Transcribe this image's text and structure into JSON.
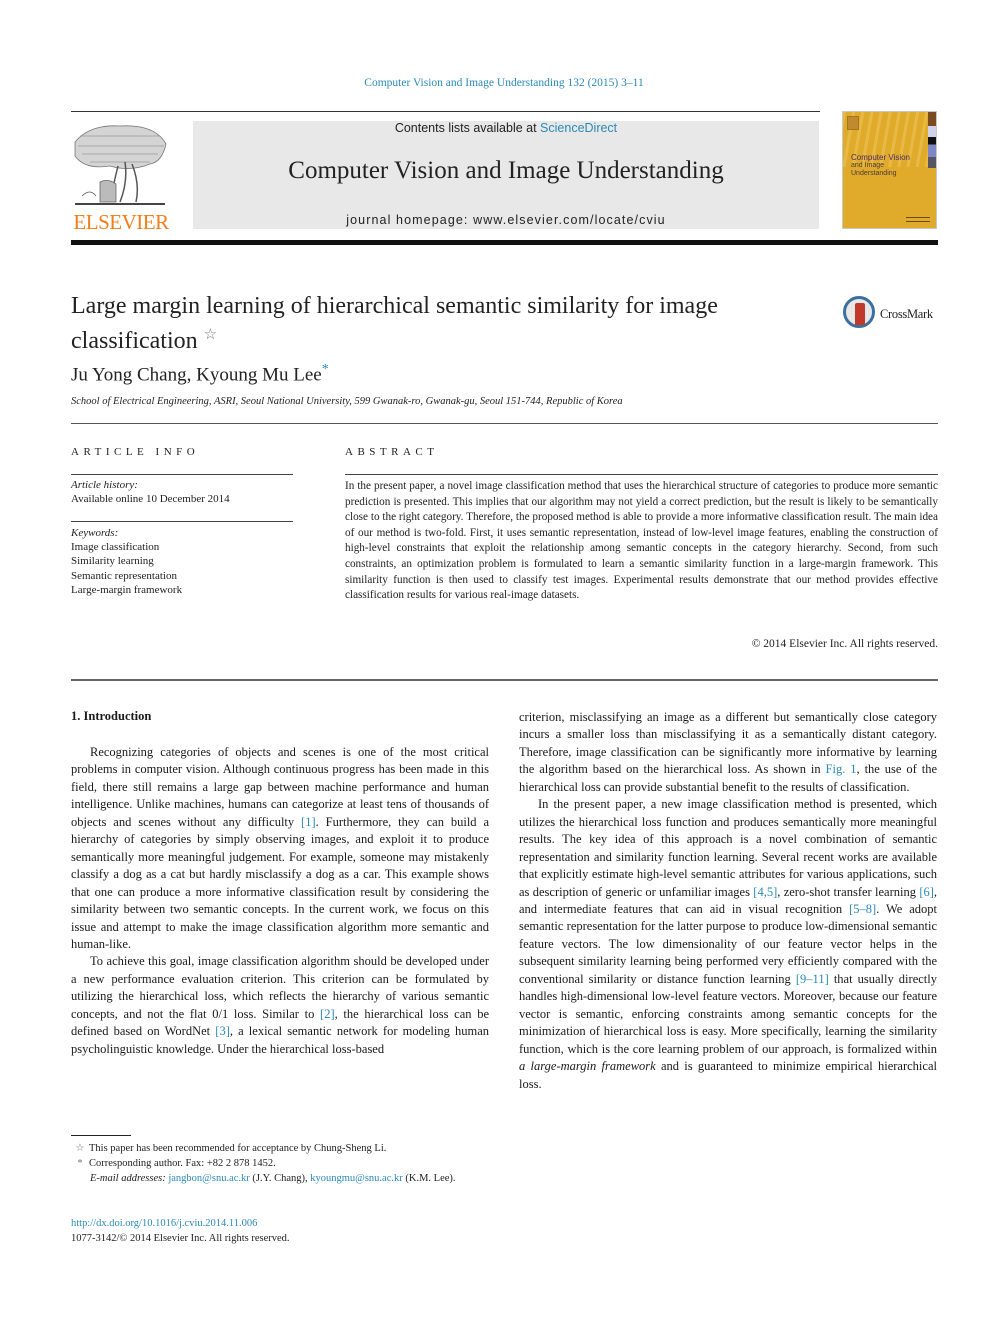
{
  "header": {
    "journal_reference": "Computer Vision and Image Understanding 132 (2015) 3–11",
    "contents_prefix": "Contents lists available at ",
    "contents_link": "ScienceDirect",
    "journal_title": "Computer Vision and Image Understanding",
    "homepage_label": "journal homepage: www.elsevier.com/locate/cviu",
    "publisher_logo_text": "ELSEVIER",
    "cover": {
      "title_line1": "Computer Vision",
      "title_line2": "and Image",
      "title_line3": "Understanding"
    }
  },
  "article": {
    "title": "Large margin learning of hierarchical semantic similarity for image classification",
    "title_footnote_mark": "☆",
    "crossmark_label": "CrossMark",
    "authors": "Ju Yong Chang, Kyoung Mu Lee",
    "corresponding_mark": "*",
    "affiliation": "School of Electrical Engineering, ASRI, Seoul National University, 599 Gwanak-ro, Gwanak-gu, Seoul 151-744, Republic of Korea"
  },
  "article_info": {
    "heading": "ARTICLE INFO",
    "history_label": "Article history:",
    "history_value": "Available online 10 December 2014",
    "keywords_label": "Keywords:",
    "keywords": [
      "Image classification",
      "Similarity learning",
      "Semantic representation",
      "Large-margin framework"
    ]
  },
  "abstract": {
    "heading": "ABSTRACT",
    "text": "In the present paper, a novel image classification method that uses the hierarchical structure of categories to produce more semantic prediction is presented. This implies that our algorithm may not yield a correct prediction, but the result is likely to be semantically close to the right category. Therefore, the proposed method is able to provide a more informative classification result. The main idea of our method is two-fold. First, it uses semantic representation, instead of low-level image features, enabling the construction of high-level constraints that exploit the relationship among semantic concepts in the category hierarchy. Second, from such constraints, an optimization problem is formulated to learn a semantic similarity function in a large-margin framework. This similarity function is then used to classify test images. Experimental results demonstrate that our method provides effective classification results for various real-image datasets.",
    "copyright": "© 2014 Elsevier Inc. All rights reserved."
  },
  "body": {
    "section_heading": "1. Introduction",
    "left_p1_a": "Recognizing categories of objects and scenes is one of the most critical problems in computer vision. Although continuous progress has been made in this field, there still remains a large gap between machine performance and human intelligence. Unlike machines, humans can categorize at least tens of thousands of objects and scenes without any difficulty ",
    "left_p1_ref": "[1]",
    "left_p1_b": ". Furthermore, they can build a hierarchy of categories by simply observing images, and exploit it to produce semantically more meaningful judgement. For example, someone may mistakenly classify a dog as a cat but hardly misclassify a dog as a car. This example shows that one can produce a more informative classification result by considering the similarity between two semantic concepts. In the current work, we focus on this issue and attempt to make the image classification algorithm more semantic and human-like.",
    "left_p2_a": "To achieve this goal, image classification algorithm should be developed under a new performance evaluation criterion. This criterion can be formulated by utilizing the hierarchical loss, which reflects the hierarchy of various semantic concepts, and not the flat 0/1 loss. Similar to ",
    "left_p2_ref1": "[2]",
    "left_p2_b": ", the hierarchical loss can be defined based on WordNet ",
    "left_p2_ref2": "[3]",
    "left_p2_c": ", a lexical semantic network for modeling human psycholinguistic knowledge. Under the hierarchical loss-based",
    "right_p1_a": "criterion, misclassifying an image as a different but semantically close category incurs a smaller loss than misclassifying it as a semantically distant category. Therefore, image classification can be significantly more informative by learning the algorithm based on the hierarchical loss. As shown in ",
    "right_p1_ref": "Fig. 1",
    "right_p1_b": ", the use of the hierarchical loss can provide substantial benefit to the results of classification.",
    "right_p2_a": "In the present paper, a new image classification method is presented, which utilizes the hierarchical loss function and produces semantically more meaningful results. The key idea of this approach is a novel combination of semantic representation and similarity function learning. Several recent works are available that explicitly estimate high-level semantic attributes for various applications, such as description of generic or unfamiliar images ",
    "right_p2_ref1": "[4,5]",
    "right_p2_b": ", zero-shot transfer learning ",
    "right_p2_ref2": "[6]",
    "right_p2_c": ", and intermediate features that can aid in visual recognition ",
    "right_p2_ref3": "[5–8]",
    "right_p2_d": ". We adopt semantic representation for the latter purpose to produce low-dimensional semantic feature vectors. The low dimensionality of our feature vector helps in the subsequent similarity learning being performed very efficiently compared with the conventional similarity or distance function learning ",
    "right_p2_ref4": "[9–11]",
    "right_p2_e": " that usually directly handles high-dimensional low-level feature vectors. Moreover, because our feature vector is semantic, enforcing constraints among semantic concepts for the minimization of hierarchical loss is easy. More specifically, learning the similarity function, which is the core learning problem of our approach, is formalized within ",
    "right_p2_em": "a large-margin framework",
    "right_p2_f": " and is guaranteed to minimize empirical hierarchical loss."
  },
  "footnotes": {
    "star_mark": "☆",
    "star_text": "This paper has been recommended for acceptance by Chung-Sheng Li.",
    "asterisk_mark": "*",
    "asterisk_text": "Corresponding author. Fax: +82 2 878 1452.",
    "email_label": "E-mail addresses:",
    "email1": "jangbon@snu.ac.kr",
    "email1_owner": " (J.Y. Chang), ",
    "email2": "kyoungmu@snu.ac.kr",
    "email2_owner": " (K.M. Lee).",
    "doi": "http://dx.doi.org/10.1016/j.cviu.2014.11.006",
    "issn_copyright": "1077-3142/© 2014 Elsevier Inc. All rights reserved."
  },
  "colors": {
    "link": "#2a8ab6",
    "elsevier_orange": "#f07e1a",
    "header_box": "#e8e8e8",
    "cover_yellow": "#e0aa2a"
  }
}
